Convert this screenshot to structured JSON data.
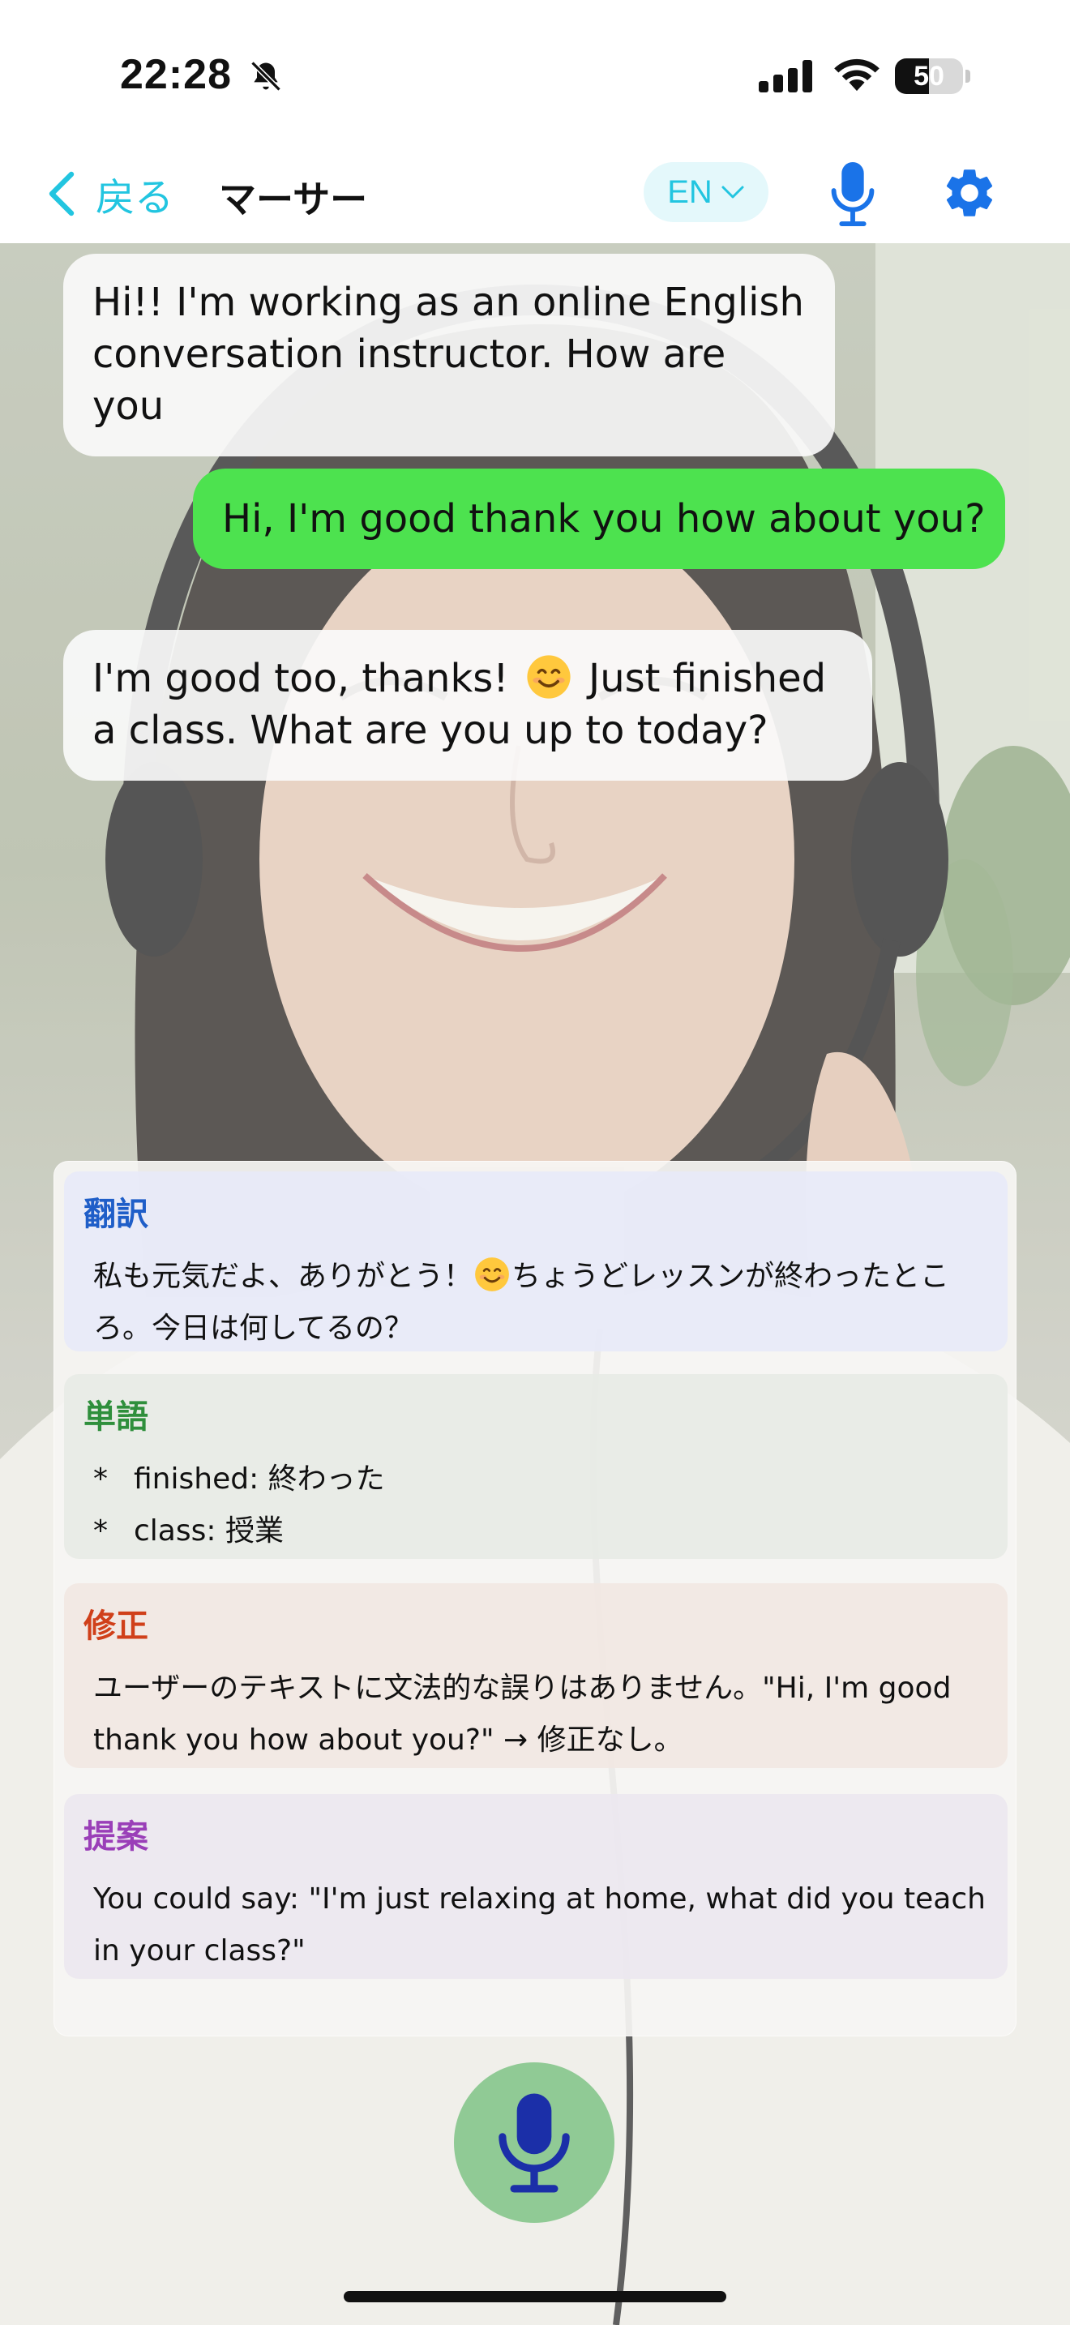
{
  "status_bar": {
    "time": "22:28",
    "battery_text": "50",
    "battery_level": 0.5
  },
  "nav": {
    "back_label": "戻る",
    "title": "マーサー",
    "language": "EN",
    "accent_color": "#22c5e0",
    "icon_color": "#1a73e8"
  },
  "chat": {
    "messages": [
      {
        "role": "assistant",
        "text": "Hi!! I'm working as an online English conversation instructor. How are you"
      },
      {
        "role": "user",
        "text": "Hi, I'm good thank you how about you?"
      },
      {
        "role": "assistant",
        "text_before": "I'm good too, thanks!",
        "text_after": "Just finished a class. What are you up to today?"
      }
    ]
  },
  "feedback": {
    "translation": {
      "title": "翻訳",
      "text_before": "私も元気だよ、ありがとう！",
      "text_after": "ちょうどレッスンが終わったところ。今日は何してるの？"
    },
    "vocabulary": {
      "title": "単語",
      "items": [
        {
          "bullet": "*",
          "text": "finished: 終わった"
        },
        {
          "bullet": "*",
          "text": "class: 授業"
        }
      ]
    },
    "correction": {
      "title": "修正",
      "text": "ユーザーのテキストに文法的な誤りはありません。\"Hi, I'm good thank you how about you?\" → 修正なし。"
    },
    "suggestion": {
      "title": "提案",
      "text": "You could say: \"I'm just relaxing at home, what did you teach in your class?\""
    }
  },
  "icons": {
    "back": "chevron-left-icon",
    "lang_dropdown": "chevron-down-icon",
    "mic": "microphone-icon",
    "settings": "gear-icon",
    "silent": "bell-slash-icon",
    "signal": "cellular-signal-icon",
    "wifi": "wifi-icon",
    "emoji": "smiling-face-icon"
  },
  "colors": {
    "user_bubble": "#4de24f",
    "translation_title": "#1f5ec8",
    "vocabulary_title": "#2f8f3c",
    "correction_title": "#d0401a",
    "suggestion_title": "#9a3fb8",
    "record_button": "#70be78"
  }
}
